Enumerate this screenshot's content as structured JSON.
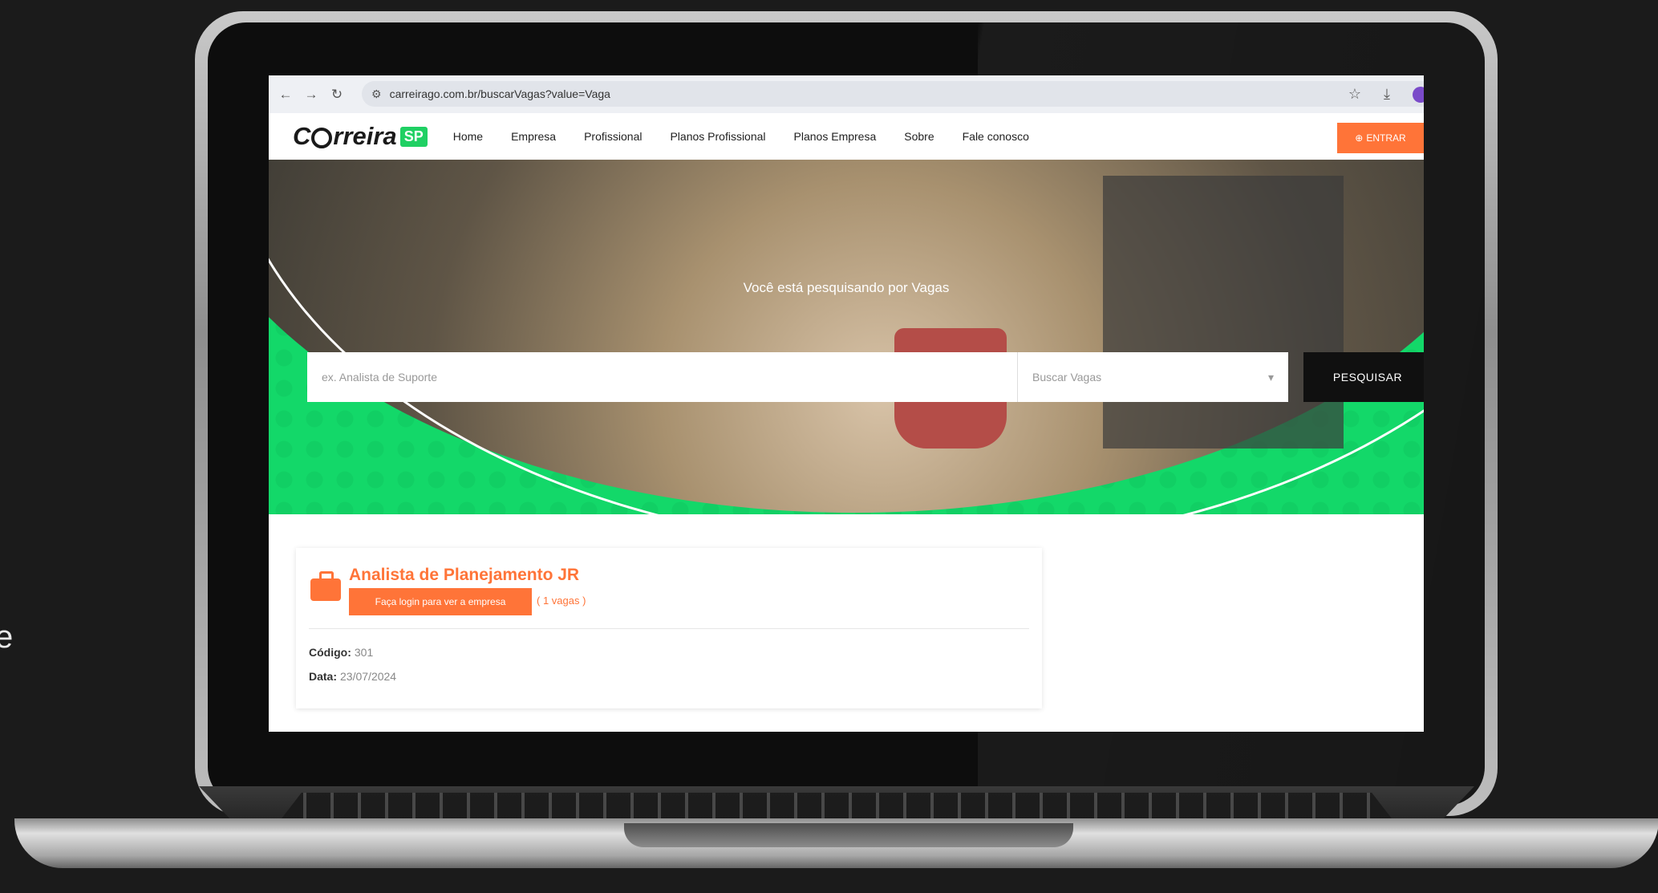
{
  "browser": {
    "url": "carreirago.com.br/buscarVagas?value=Vaga",
    "icons": [
      "back-icon",
      "forward-icon",
      "reload-icon",
      "tune-icon",
      "star-icon",
      "download-icon",
      "profile-icon"
    ]
  },
  "site": {
    "logo_text_pre": "C",
    "logo_text_post": "rreira",
    "logo_badge": "SP",
    "menu": [
      "Home",
      "Empresa",
      "Profissional",
      "Planos Profissional",
      "Planos Empresa",
      "Sobre",
      "Fale conosco"
    ],
    "enter_label": "ENTRAR"
  },
  "hero": {
    "message": "Você está pesquisando por Vagas",
    "search_placeholder": "ex. Analista de Suporte",
    "select_value": "Buscar Vagas",
    "search_button": "PESQUISAR"
  },
  "job": {
    "title": "Analista de Planejamento JR",
    "login_button": "Faça login para ver a empresa",
    "vagas": "( 1 vagas )",
    "code_label": "Código:",
    "code": "301",
    "date_label": "Data:",
    "date": "23/07/2024"
  },
  "stray_text": "e",
  "colors": {
    "brand_green": "#13d869",
    "accent_orange": "#ff7438",
    "dark": "#101010"
  }
}
